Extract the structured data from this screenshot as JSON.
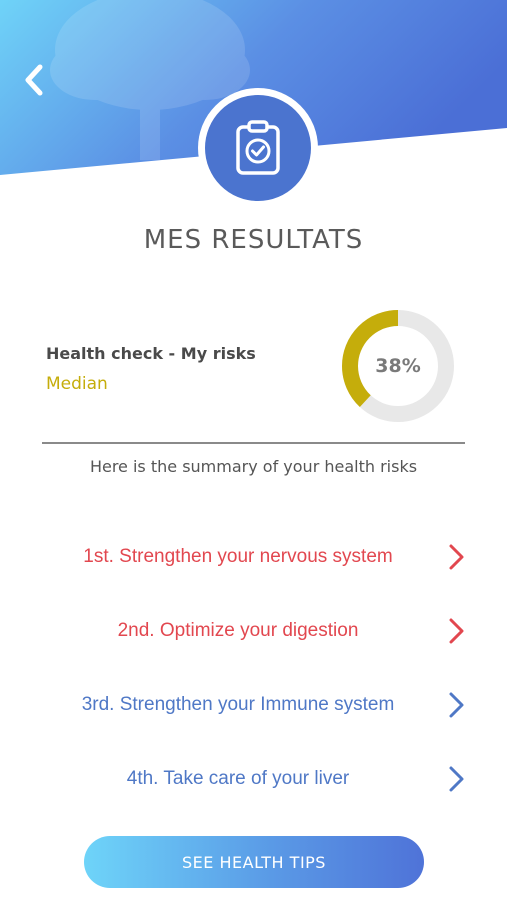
{
  "header": {
    "back_icon": "chevron-left-icon",
    "badge_icon": "clipboard-check-icon",
    "colors": {
      "gradient_start": "#6fd3f8",
      "gradient_end": "#4b6fd6"
    }
  },
  "page_title": "MES RESULTATS",
  "health_check": {
    "title": "Health check - My risks",
    "level": "Median",
    "level_color": "#c5ad0b",
    "score_label": "38%",
    "score_fraction": 0.38
  },
  "summary_text": "Here is the summary of your health risks",
  "risks": [
    {
      "label": "1st. Strengthen your nervous system",
      "color": "#e2474f",
      "icon": "chevron-right-icon"
    },
    {
      "label": "2nd. Optimize your digestion",
      "color": "#e2474f",
      "icon": "chevron-right-icon"
    },
    {
      "label": "3rd. Strengthen your Immune system",
      "color": "#4f78c6",
      "icon": "chevron-right-icon"
    },
    {
      "label": "4th. Take care of your liver",
      "color": "#4f78c6",
      "icon": "chevron-right-icon"
    }
  ],
  "cta": {
    "label": "SEE HEALTH TIPS"
  }
}
